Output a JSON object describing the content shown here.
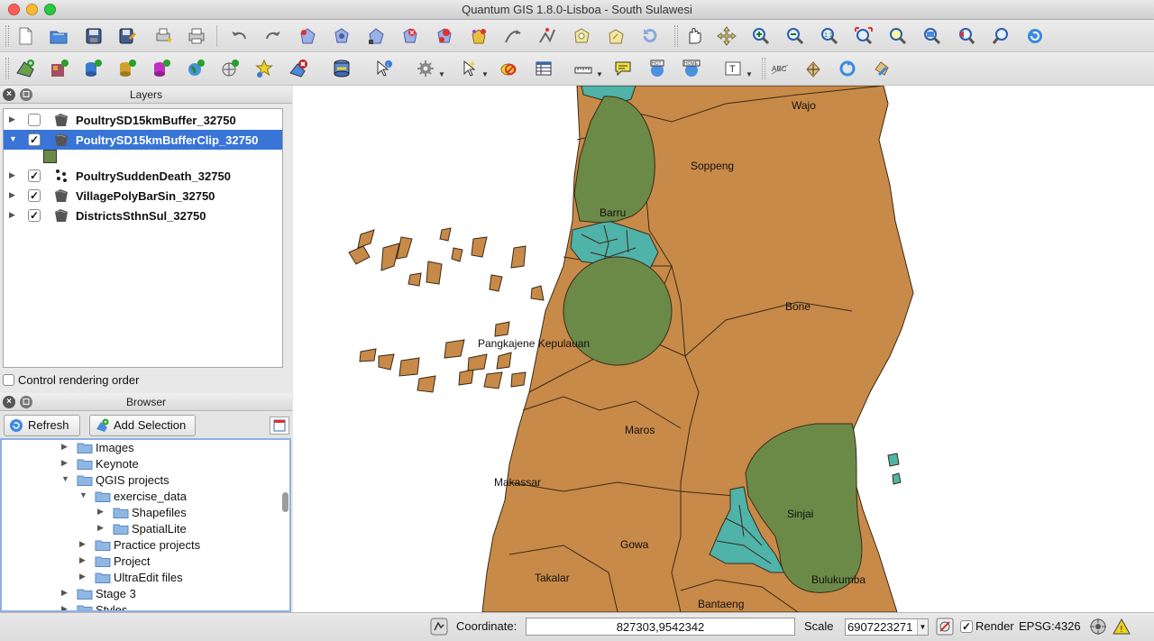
{
  "window": {
    "title": "Quantum GIS 1.8.0-Lisboa - South Sulawesi"
  },
  "toolbar1": {
    "icons": [
      "new-project-icon",
      "open-project-icon",
      "save-project-icon",
      "save-as-icon",
      "new-print-composer-icon",
      "print-icon",
      "undo-icon",
      "redo-icon",
      "add-feature-icon",
      "move-feature-icon",
      "node-tool-icon",
      "delete-selected-icon",
      "cut-features-icon",
      "copy-features-icon",
      "paste-features-icon",
      "capture-line-icon",
      "digitize-icon",
      "add-ring-icon",
      "rotate-icon",
      "pan-icon",
      "pan-to-selection-icon",
      "zoom-in-icon",
      "zoom-out-icon",
      "zoom-actual-icon",
      "zoom-full-icon",
      "zoom-selection-icon",
      "zoom-layer-icon",
      "zoom-last-icon",
      "zoom-next-icon",
      "refresh-icon"
    ]
  },
  "toolbar2": {
    "icons": [
      "add-vector-layer-icon",
      "add-raster-layer-icon",
      "add-postgis-layer-icon",
      "add-spatialite-layer-icon",
      "add-mssql-layer-icon",
      "add-wms-layer-icon",
      "add-wfs-layer-icon",
      "new-shapefile-icon",
      "remove-layer-icon",
      "database-icon",
      "identify-icon",
      "action-icon",
      "select-icon",
      "deselect-icon",
      "attribute-table-icon",
      "measure-icon",
      "map-tips-icon",
      "new-bookmark-icon",
      "show-bookmarks-icon",
      "text-annotation-icon",
      "label-icon",
      "move-label-icon",
      "rotate-label-icon",
      "change-label-icon"
    ]
  },
  "layers_panel": {
    "title": "Layers",
    "layers": [
      {
        "name": "PoultrySD15kmBuffer_32750",
        "checked": false,
        "selected": false,
        "expanded": false,
        "icon": "polygon-layer-icon"
      },
      {
        "name": "PoultrySD15kmBufferClip_32750",
        "checked": true,
        "selected": true,
        "expanded": true,
        "icon": "polygon-layer-icon"
      },
      {
        "name": "PoultrySuddenDeath_32750",
        "checked": true,
        "selected": false,
        "expanded": false,
        "icon": "point-layer-icon"
      },
      {
        "name": "VillagePolyBarSin_32750",
        "checked": true,
        "selected": false,
        "expanded": false,
        "icon": "polygon-layer-icon"
      },
      {
        "name": "DistrictsSthnSul_32750",
        "checked": true,
        "selected": false,
        "expanded": false,
        "icon": "polygon-layer-icon"
      }
    ],
    "legend_color": "#6b8a48",
    "control_rendering_order": "Control rendering order"
  },
  "browser_panel": {
    "title": "Browser",
    "refresh_label": "Refresh",
    "add_selection_label": "Add Selection",
    "items": [
      {
        "label": "Images",
        "level": 0,
        "expanded": false
      },
      {
        "label": "Keynote",
        "level": 0,
        "expanded": false
      },
      {
        "label": "QGIS projects",
        "level": 0,
        "expanded": true
      },
      {
        "label": "exercise_data",
        "level": 1,
        "expanded": true
      },
      {
        "label": "Shapefiles",
        "level": 2,
        "expanded": false
      },
      {
        "label": "SpatialLite",
        "level": 2,
        "expanded": false
      },
      {
        "label": "Practice projects",
        "level": 1,
        "expanded": false
      },
      {
        "label": "Project",
        "level": 1,
        "expanded": false
      },
      {
        "label": "UltraEdit files",
        "level": 1,
        "expanded": false
      },
      {
        "label": "Stage 3",
        "level": 0,
        "expanded": false
      },
      {
        "label": "Styles",
        "level": 0,
        "expanded": false
      }
    ]
  },
  "map": {
    "colors": {
      "district": "#c88a48",
      "buffer": "#6b8a48",
      "village": "#4fb3a9",
      "outline": "#3a2a1a"
    },
    "labels": [
      "Wajo",
      "Soppeng",
      "Barru",
      "Bone",
      "Pangkajene Kepulauan",
      "Maros",
      "Makassar",
      "Sinjai",
      "Gowa",
      "Takalar",
      "Bulukumba",
      "Bantaeng"
    ]
  },
  "statusbar": {
    "coordinate_label": "Coordinate:",
    "coordinate_value": "827303,9542342",
    "scale_label": "Scale",
    "scale_value": "6907223271",
    "render_label": "Render",
    "render_checked": true,
    "crs": "EPSG:4326"
  }
}
